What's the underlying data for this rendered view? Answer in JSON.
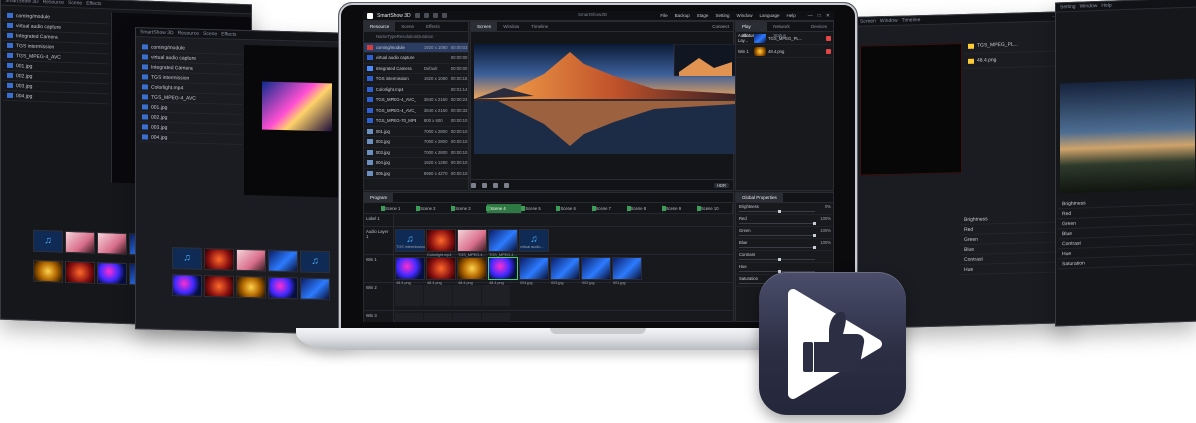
{
  "app": {
    "name": "SmartShow 3D",
    "window_title": "SmartShow3D",
    "menu": [
      "File",
      "Backup",
      "Stage",
      "Setting",
      "Window",
      "Language",
      "Help"
    ],
    "window_controls": [
      "—",
      "□",
      "✕"
    ]
  },
  "resource_pane": {
    "tabs": [
      "Resource",
      "Scene",
      "Effects"
    ],
    "active_tab": "Resource",
    "columns": [
      "Name",
      "Type",
      "Resolution",
      "Duration"
    ],
    "items": [
      {
        "name": "coming/module",
        "resolution": "1920 x 1080",
        "duration": "00:00:03"
      },
      {
        "name": "virtual audio capture",
        "resolution": "",
        "duration": "00:00:00"
      },
      {
        "name": "Integrated Camera",
        "resolution": "Default",
        "duration": "00:00:00"
      },
      {
        "name": "TGS intermission",
        "resolution": "1920 x 1080",
        "duration": "00:00:15"
      },
      {
        "name": "Colorlight.mp4",
        "resolution": "",
        "duration": "00:01:14"
      },
      {
        "name": "TGS_MPEG-4_AVC_3a...",
        "resolution": "3840 x 2160",
        "duration": "00:00:23"
      },
      {
        "name": "TGS_MPEG-4_AVC_3a...",
        "resolution": "3840 x 2160",
        "duration": "00:00:33"
      },
      {
        "name": "TGS_MPEG-70_MPE...",
        "resolution": "800 x 600",
        "duration": "00:00:10"
      },
      {
        "name": "001.jpg",
        "resolution": "7000 x 2800",
        "duration": "00:00:10"
      },
      {
        "name": "002.jpg",
        "resolution": "7000 x 2800",
        "duration": "00:00:10"
      },
      {
        "name": "003.jpg",
        "resolution": "7000 x 2800",
        "duration": "00:00:10"
      },
      {
        "name": "004.jpg",
        "resolution": "1920 x 1280",
        "duration": "00:00:10"
      },
      {
        "name": "005.jpg",
        "resolution": "8960 x 4270",
        "duration": "00:00:10"
      }
    ]
  },
  "preview_pane": {
    "tabs": [
      "Screen",
      "Window",
      "Timeline"
    ],
    "active_tab": "Screen",
    "connect_label": "Connect",
    "mode_pill": "HDR"
  },
  "play_status": {
    "tabs": [
      "Play Status",
      "Network Status",
      "Devices"
    ],
    "active_tab": "Play Status",
    "rows": [
      {
        "label": "Audio Lay...",
        "name": "TGS_MPEG_PL..."
      },
      {
        "label": "Win 1",
        "name": "48.4.png"
      }
    ]
  },
  "program": {
    "title": "Program",
    "scenes": [
      "Scene 1",
      "Scene 2",
      "Scene 3",
      "Scene 4",
      "Scene 5",
      "Scene 6",
      "Scene 7",
      "Scene 8",
      "Scene 9",
      "Scene 10"
    ],
    "active_scene": 3,
    "layers": [
      {
        "name": "Label 1",
        "type": "label"
      },
      {
        "name": "Audio Layer 1",
        "type": "audio"
      },
      {
        "name": "Win 1",
        "type": "video"
      },
      {
        "name": "Win 2",
        "type": "video"
      },
      {
        "name": "Win 3",
        "type": "video"
      }
    ],
    "audio_cells": [
      {
        "kind": "music",
        "caption": "TGS intermission"
      },
      {
        "kind": "red",
        "caption": "Colorlight.mp4"
      },
      {
        "kind": "pink",
        "caption": "TGS_MPEG-4..."
      },
      {
        "kind": "blue",
        "caption": "TGS_MPEG-4..."
      },
      {
        "kind": "music",
        "caption": "virtual audio..."
      }
    ],
    "video_cells": [
      {
        "kind": "swirl",
        "caption": "48.4.png"
      },
      {
        "kind": "red",
        "caption": "48.4.png"
      },
      {
        "kind": "gold",
        "caption": "48.4.png"
      },
      {
        "kind": "swirl",
        "caption": "48.4.png",
        "highlight": true
      },
      {
        "kind": "blue",
        "caption": "004.jpg"
      },
      {
        "kind": "blue",
        "caption": "003.jpg"
      },
      {
        "kind": "blue",
        "caption": "002.jpg"
      },
      {
        "kind": "blue",
        "caption": "001.jpg"
      }
    ]
  },
  "global_properties": {
    "title": "Global Properties",
    "items": [
      {
        "name": "Brightness",
        "value": "0%",
        "level": 0.5
      },
      {
        "name": "Red",
        "value": "100%",
        "level": 0.95
      },
      {
        "name": "Green",
        "value": "100%",
        "level": 0.95
      },
      {
        "name": "Blue",
        "value": "100%",
        "level": 0.95
      },
      {
        "name": "Contrast",
        "value": "",
        "level": 0.5
      },
      {
        "name": "Hue",
        "value": "",
        "level": 0.5
      },
      {
        "name": "Saturation",
        "value": "",
        "level": 0.5
      }
    ]
  },
  "colors": {
    "accent_green": "#2f7a43",
    "highlight_green": "#41d16a",
    "selection_blue": "#2b3d63",
    "logo_bg": "#2c2e44"
  }
}
